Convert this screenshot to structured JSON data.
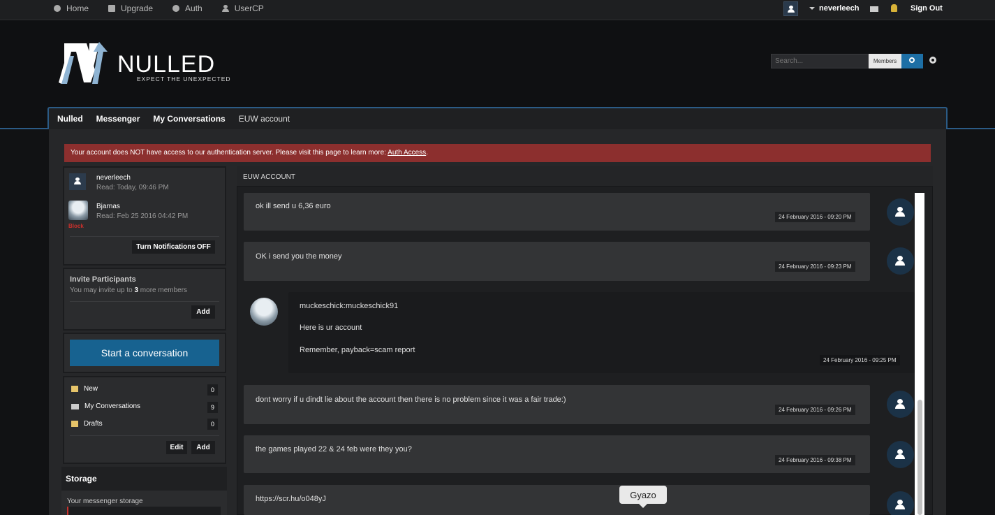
{
  "topbar": {
    "nav": [
      {
        "label": "Home",
        "icon": "chat-bubble-icon"
      },
      {
        "label": "Upgrade",
        "icon": "gift-icon"
      },
      {
        "label": "Auth",
        "icon": "globe-icon"
      },
      {
        "label": "UserCP",
        "icon": "user-icon"
      }
    ],
    "username": "neverleech",
    "signout": "Sign Out"
  },
  "header": {
    "logo_text": "NULLED",
    "tagline": "EXPECT THE UNEXPECTED",
    "search_placeholder": "Search...",
    "search_scope": "Members"
  },
  "breadcrumbs": [
    "Nulled",
    "Messenger",
    "My Conversations",
    "EUW account"
  ],
  "alert": {
    "text": "Your account does NOT have access to our authentication server. Please visit this page to learn more: ",
    "link": "Auth Access",
    "suffix": "."
  },
  "participants": [
    {
      "name": "neverleech",
      "read": "Read: Today, 09:46 PM"
    },
    {
      "name": "Bjarnas",
      "read": "Read: Feb 25 2016 04:42 PM",
      "tag": "Block"
    }
  ],
  "notifications": {
    "label": "Turn Notifications ",
    "state": "OFF"
  },
  "invite": {
    "title": "Invite Participants",
    "desc_pre": "You may invite up to ",
    "desc_num": "3",
    "desc_post": " more members",
    "add": "Add"
  },
  "start_conversation": "Start a conversation",
  "folders": [
    {
      "label": "New",
      "count": "0"
    },
    {
      "label": "My Conversations",
      "count": "9"
    },
    {
      "label": "Drafts",
      "count": "0"
    }
  ],
  "folder_actions": {
    "edit": "Edit",
    "add": "Add"
  },
  "storage": {
    "title": "Storage",
    "label": "Your messenger storage"
  },
  "conversation": {
    "title": "EUW ACCOUNT",
    "messages": [
      {
        "text": "ok ill send u 6,36 euro",
        "time": "24 February 2016 - 09:20 PM"
      },
      {
        "text": "OK i send you the money",
        "time": "24 February 2016 - 09:23 PM"
      },
      {
        "lines": [
          "muckeschick:muckeschick91",
          "Here is ur account",
          "Remember, payback=scam report"
        ],
        "time": "24 February 2016 - 09:25 PM"
      },
      {
        "text": "dont worry if u dindt lie about the account then there is no problem since it was a fair trade:)",
        "time": "24 February 2016 - 09:26 PM"
      },
      {
        "text": "the games played 22 & 24 feb were they you?",
        "time": "24 February 2016 - 09:38 PM"
      },
      {
        "text": "https://scr.hu/o048yJ"
      }
    ]
  },
  "tooltip": "Gyazo",
  "colors": {
    "accent": "#176290",
    "alert": "#8c2f2e",
    "border_blue": "#2b5b86"
  }
}
